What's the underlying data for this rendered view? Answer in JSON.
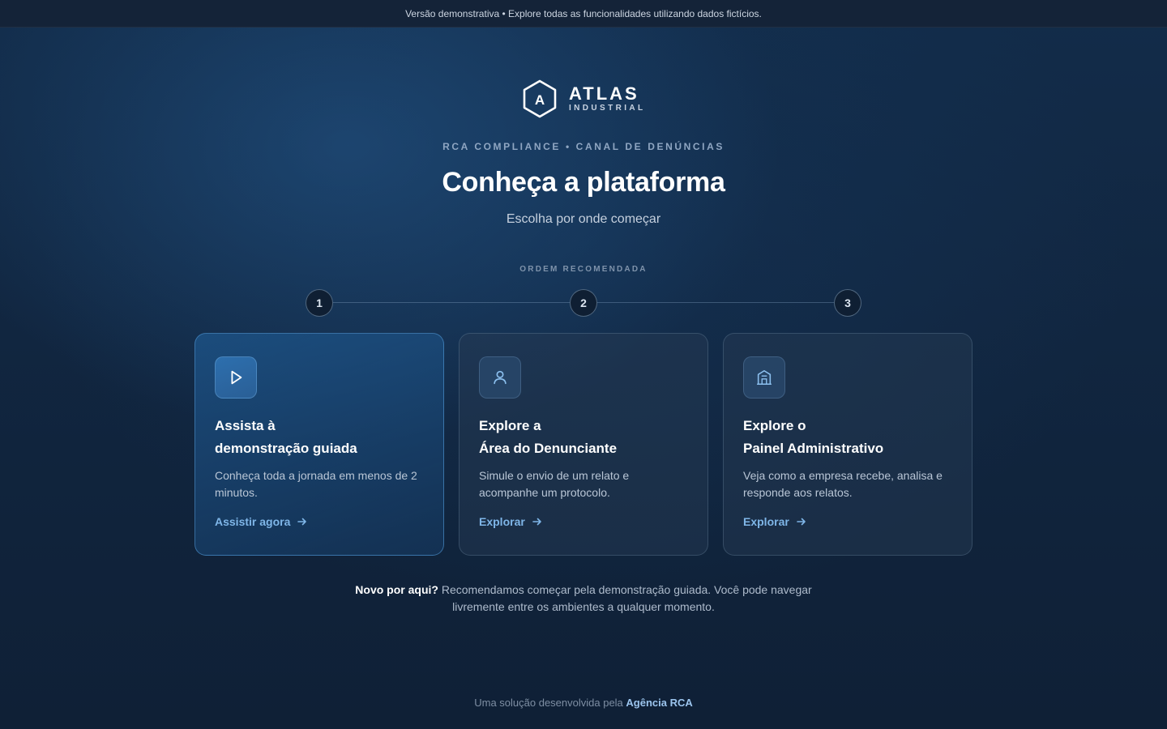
{
  "banner": {
    "text": "Versão demonstrativa • Explore todas as funcionalidades utilizando dados fictícios."
  },
  "logo": {
    "name": "ATLAS",
    "subtitle": "INDUSTRIAL",
    "letter": "A"
  },
  "header": {
    "eyebrow": "RCA COMPLIANCE • CANAL DE DENÚNCIAS",
    "title": "Conheça a plataforma",
    "subtitle": "Escolha por onde começar"
  },
  "order": {
    "label": "ORDEM RECOMENDADA",
    "steps": [
      "1",
      "2",
      "3"
    ]
  },
  "cards": [
    {
      "icon": "play-icon",
      "title_line1": "Assista à",
      "title_line2": "demonstração guiada",
      "description": "Conheça toda a jornada em menos de 2 minutos.",
      "link": "Assistir agora"
    },
    {
      "icon": "user-icon",
      "title_line1": "Explore a",
      "title_line2": "Área do Denunciante",
      "description": "Simule o envio de um relato e acompanhe um protocolo.",
      "link": "Explorar"
    },
    {
      "icon": "building-icon",
      "title_line1": "Explore o",
      "title_line2": "Painel Administrativo",
      "description": "Veja como a empresa recebe, analisa e responde aos relatos.",
      "link": "Explorar"
    }
  ],
  "note": {
    "lead": "Novo por aqui?",
    "text": " Recomendamos começar pela demonstração guiada. Você pode navegar livremente entre os ambientes a qualquer momento."
  },
  "footer": {
    "text": "Uma solução desenvolvida pela ",
    "link": "Agência RCA"
  },
  "colors": {
    "accent": "#7fb6e8",
    "background": "#112640",
    "primary_card": "#1e568c"
  }
}
